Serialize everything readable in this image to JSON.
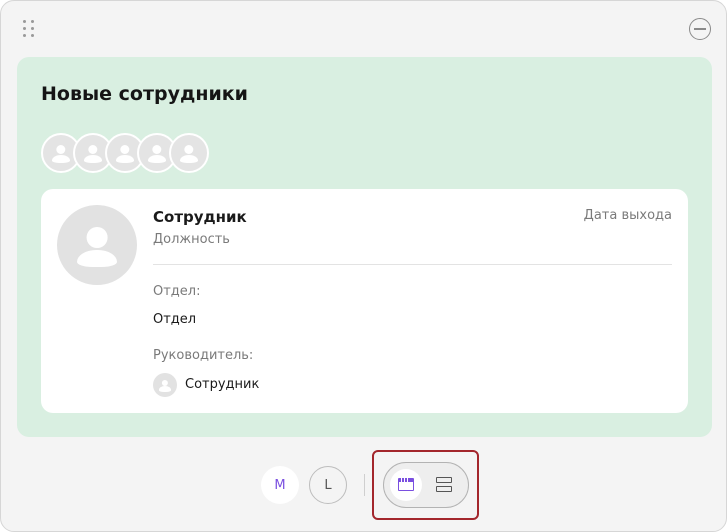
{
  "widget": {
    "title": "Новые сотрудники",
    "avatar_count": 5,
    "card": {
      "name": "Сотрудник",
      "position": "Должность",
      "exit_date_label": "Дата выхода",
      "department_label": "Отдел:",
      "department_value": "Отдел",
      "manager_label": "Руководитель:",
      "manager_name": "Сотрудник"
    },
    "background_color": "#d9efe1"
  },
  "controls": {
    "size_m": "M",
    "size_l": "L",
    "selected_size": "M",
    "layout_options": [
      "compact-layout-icon",
      "rows-layout-icon"
    ],
    "selected_layout": "compact-layout-icon",
    "accent_color": "#7a4fe0",
    "highlight_color": "#a3262c"
  }
}
